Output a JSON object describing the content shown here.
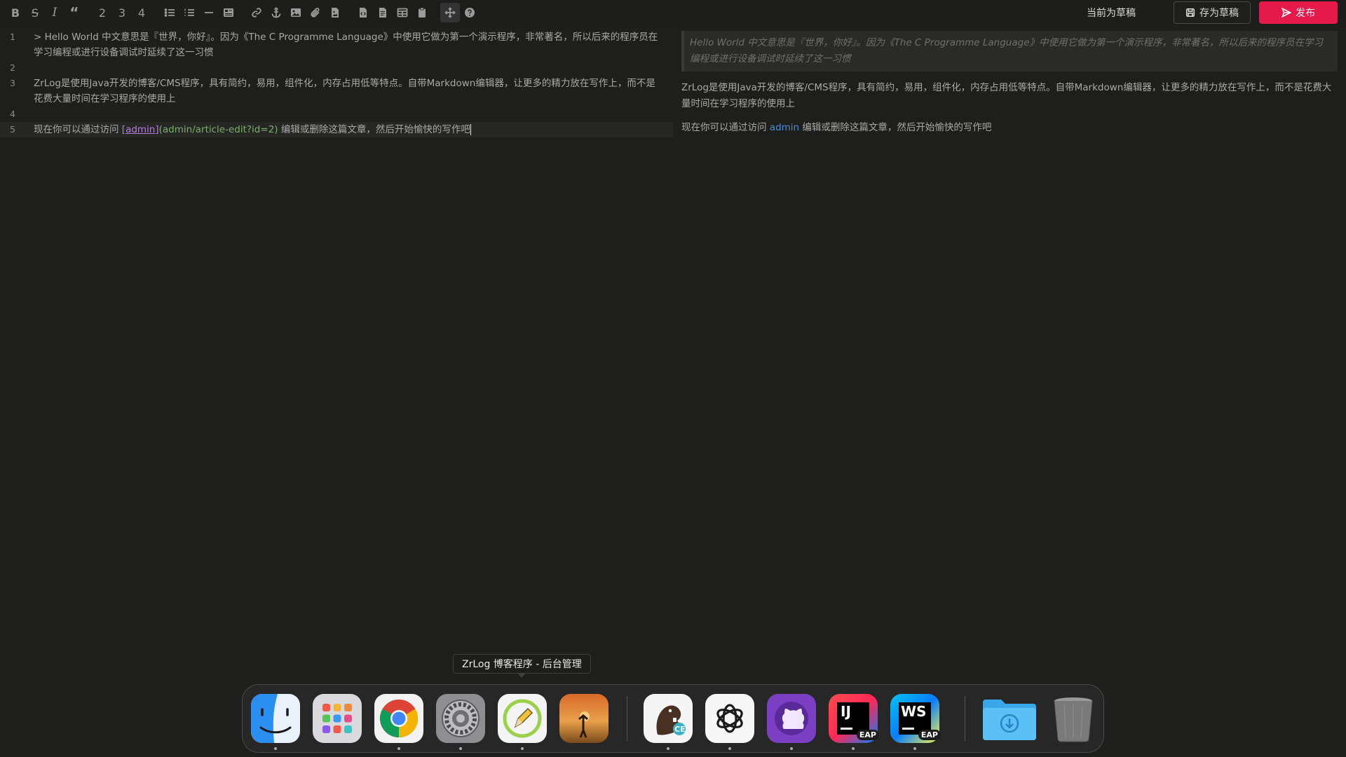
{
  "toolbar": {
    "heading2": "2",
    "heading3": "3",
    "heading4": "4",
    "status": "当前为草稿",
    "save_draft": "存为草稿",
    "publish": "发布"
  },
  "editor": {
    "lines": [
      {
        "num": "1",
        "text": "> Hello World 中文意思是『世界，你好』。因为《The C Programme Language》中使用它做为第一个演示程序，非常著名，所以后来的程序员在学习编程或进行设备调试时延续了这一习惯"
      },
      {
        "num": "2",
        "text": ""
      },
      {
        "num": "3",
        "text": "ZrLog是使用Java开发的博客/CMS程序，具有简约，易用，组件化，内存占用低等特点。自带Markdown编辑器，让更多的精力放在写作上，而不是花费大量时间在学习程序的使用上"
      },
      {
        "num": "4",
        "text": ""
      },
      {
        "num": "5",
        "prefix": "现在你可以通过访问 ",
        "link_text": "[admin]",
        "link_url": "(admin/article-edit?id=2)",
        "suffix": " 编辑或删除这篇文章，然后开始愉快的写作吧"
      }
    ]
  },
  "preview": {
    "quote": "Hello World 中文意思是『世界，你好』。因为《The C Programme Language》中使用它做为第一个演示程序，非常著名，所以后来的程序员在学习编程或进行设备调试时延续了这一习惯",
    "para1": "ZrLog是使用Java开发的博客/CMS程序，具有简约，易用，组件化，内存占用低等特点。自带Markdown编辑器，让更多的精力放在写作上，而不是花费大量时间在学习程序的使用上",
    "para2_prefix": "现在你可以通过访问 ",
    "para2_link": "admin",
    "para2_suffix": " 编辑或删除这篇文章，然后开始愉快的写作吧"
  },
  "dock": {
    "tooltip": "ZrLog 博客程序 - 后台管理",
    "ij_label": "IJ",
    "ws_label": "WS",
    "eap_badge": "EAP",
    "ce_badge": "CE"
  }
}
